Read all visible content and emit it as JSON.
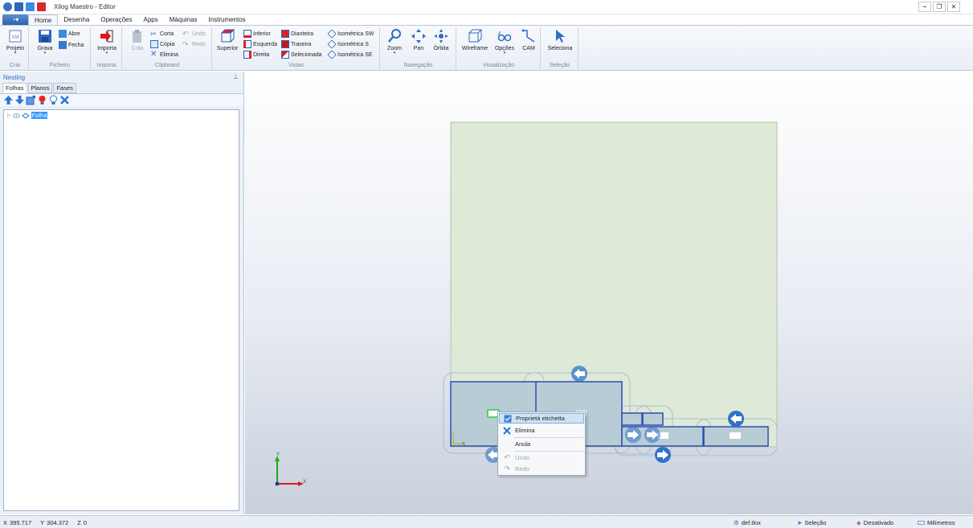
{
  "window": {
    "title": "Xilog Maestro - Editor",
    "minimize_glyph": "–",
    "restore_glyph": "❐",
    "close_glyph": "✕"
  },
  "ribbon_tabs": [
    "Home",
    "Desenha",
    "Operações",
    "Apps",
    "Máquinas",
    "Instrumentos"
  ],
  "app_menu_glyph": "◔▾",
  "ribbon": {
    "cria": {
      "label": "Cria",
      "projeto": "Projeto"
    },
    "ficheiro": {
      "label": "Ficheiro",
      "grava": "Grava",
      "abre": "Abre",
      "fecha": "Fecha"
    },
    "importa": {
      "label": "Importa",
      "importa_btn": "Importa"
    },
    "clipboard": {
      "label": "Clipboard",
      "cola": "Cola",
      "corta": "Corta",
      "copia": "Cópia",
      "elimina": "Elimina",
      "undo": "Undo",
      "redo": "Redo"
    },
    "vistas": {
      "label": "Vistas",
      "superior": "Superior",
      "inferior": "Inferior",
      "esquerda": "Esquerda",
      "direita": "Direita",
      "dianteira": "Dianteira",
      "traseira": "Traseira",
      "selecionada": "Selecionada",
      "iso_sw": "Isométrica SW",
      "iso_s": "Isométrica S",
      "iso_se": "Isométrica SE"
    },
    "navegacao": {
      "label": "Navegação",
      "zoom": "Zoom",
      "pan": "Pan",
      "orbita": "Órbita"
    },
    "visualizacao": {
      "label": "Visualização",
      "wireframe": "Wireframe",
      "opcoes": "Opções",
      "cam": "CAM"
    },
    "selecao": {
      "label": "Seleção",
      "seleciona": "Seleciona"
    }
  },
  "panel": {
    "title": "Nesting",
    "pin_glyph": "⊥",
    "tabs": [
      "Folhas",
      "Planos",
      "Fases"
    ],
    "tree": {
      "expander": "▷",
      "item": "Folha"
    }
  },
  "axes": {
    "x_label": "X",
    "y_label": "Y",
    "mini_label": "X"
  },
  "context_menu": {
    "propriedades": "Proprietà etichetta",
    "elimina": "Elimina",
    "anula": "Anula",
    "undo": "Undo",
    "redo": "Redo"
  },
  "status": {
    "x_label": "X",
    "x_value": "395.717",
    "y_label": "Y",
    "y_value": "304.372",
    "z_label": "Z",
    "z_value": "0",
    "file": "def.tlox",
    "mode": "Seleção",
    "snap": "Desativado",
    "units": "Milímetros"
  },
  "colors": {
    "accent": "#2f6cc2",
    "sheet_fill": "#dfe9d8",
    "panel_blue": "#2a4fb0",
    "arrow_blue": "#2f73c8"
  }
}
